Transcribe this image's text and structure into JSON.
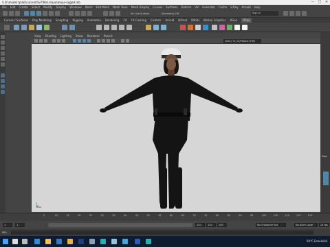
{
  "title_bar": {
    "text": "S  D:\\model tp\\lat\\current\\Sv7\\Mal.mayo\\maya-rigged.mb",
    "minimize": "—",
    "maximize": "□",
    "close": "✕"
  },
  "menu": [
    "File",
    "Edit",
    "Create",
    "Select",
    "Modify",
    "Display",
    "Windows",
    "Mesh",
    "Edit Mesh",
    "Mesh Tools",
    "Mesh Display",
    "Curves",
    "Surfaces",
    "Deform",
    "UV",
    "Generate",
    "Cache",
    "V-Ray",
    "Arnold",
    "Help"
  ],
  "status_line": {
    "live_surface": "No Live Surface",
    "symmetry": "Symmetry: Off",
    "sign_in": "Sign In"
  },
  "shelf_tabs": [
    "Curves / Surfaces",
    "Poly Modeling",
    "Sculpting",
    "Rigging",
    "Animation",
    "Rendering",
    "FX",
    "FX Caching",
    "Custom",
    "Arnold",
    "Bifrost",
    "MASH",
    "Motion Graphics",
    "XGen",
    "VRay"
  ],
  "active_shelf_tab": "VRay",
  "panel_menu": [
    "View",
    "Shading",
    "Lighting",
    "Show",
    "Renderer",
    "Panels"
  ],
  "camera_field": "(SGS) 'cf_Ch/Potato':(FW)",
  "channel_box": {
    "label": "Disp"
  },
  "time_ticks": [
    "5",
    "10",
    "15",
    "20",
    "25",
    "30",
    "35",
    "40",
    "45",
    "50",
    "55",
    "60",
    "65",
    "70",
    "75",
    "80",
    "85",
    "90",
    "95",
    "100",
    "105",
    "110",
    "115",
    "120"
  ],
  "range": {
    "start": "1",
    "start_inner": "1",
    "end_inner": "120",
    "end": "120",
    "end_anim": "200",
    "character_set": "No Character Set",
    "anim_layer": "No Anim Layer",
    "fps": "24 fps"
  },
  "mel_label": "MEL",
  "taskbar": {
    "weather": "50°C  Ensoleillé",
    "icons": [
      "windows-icon",
      "search-icon",
      "task-view-icon",
      "edge-icon",
      "explorer-icon",
      "store-icon",
      "chrome-icon",
      "photoshop-icon",
      "steam-icon",
      "maya-icon",
      "notepad-icon",
      "photos-icon",
      "word-icon",
      "maya-window-icon"
    ]
  },
  "colors": {
    "viewport_bg": "#d6d6d6",
    "figure": "#141414",
    "accent": "#5285a6",
    "taskbar": "#0f1b2e"
  }
}
